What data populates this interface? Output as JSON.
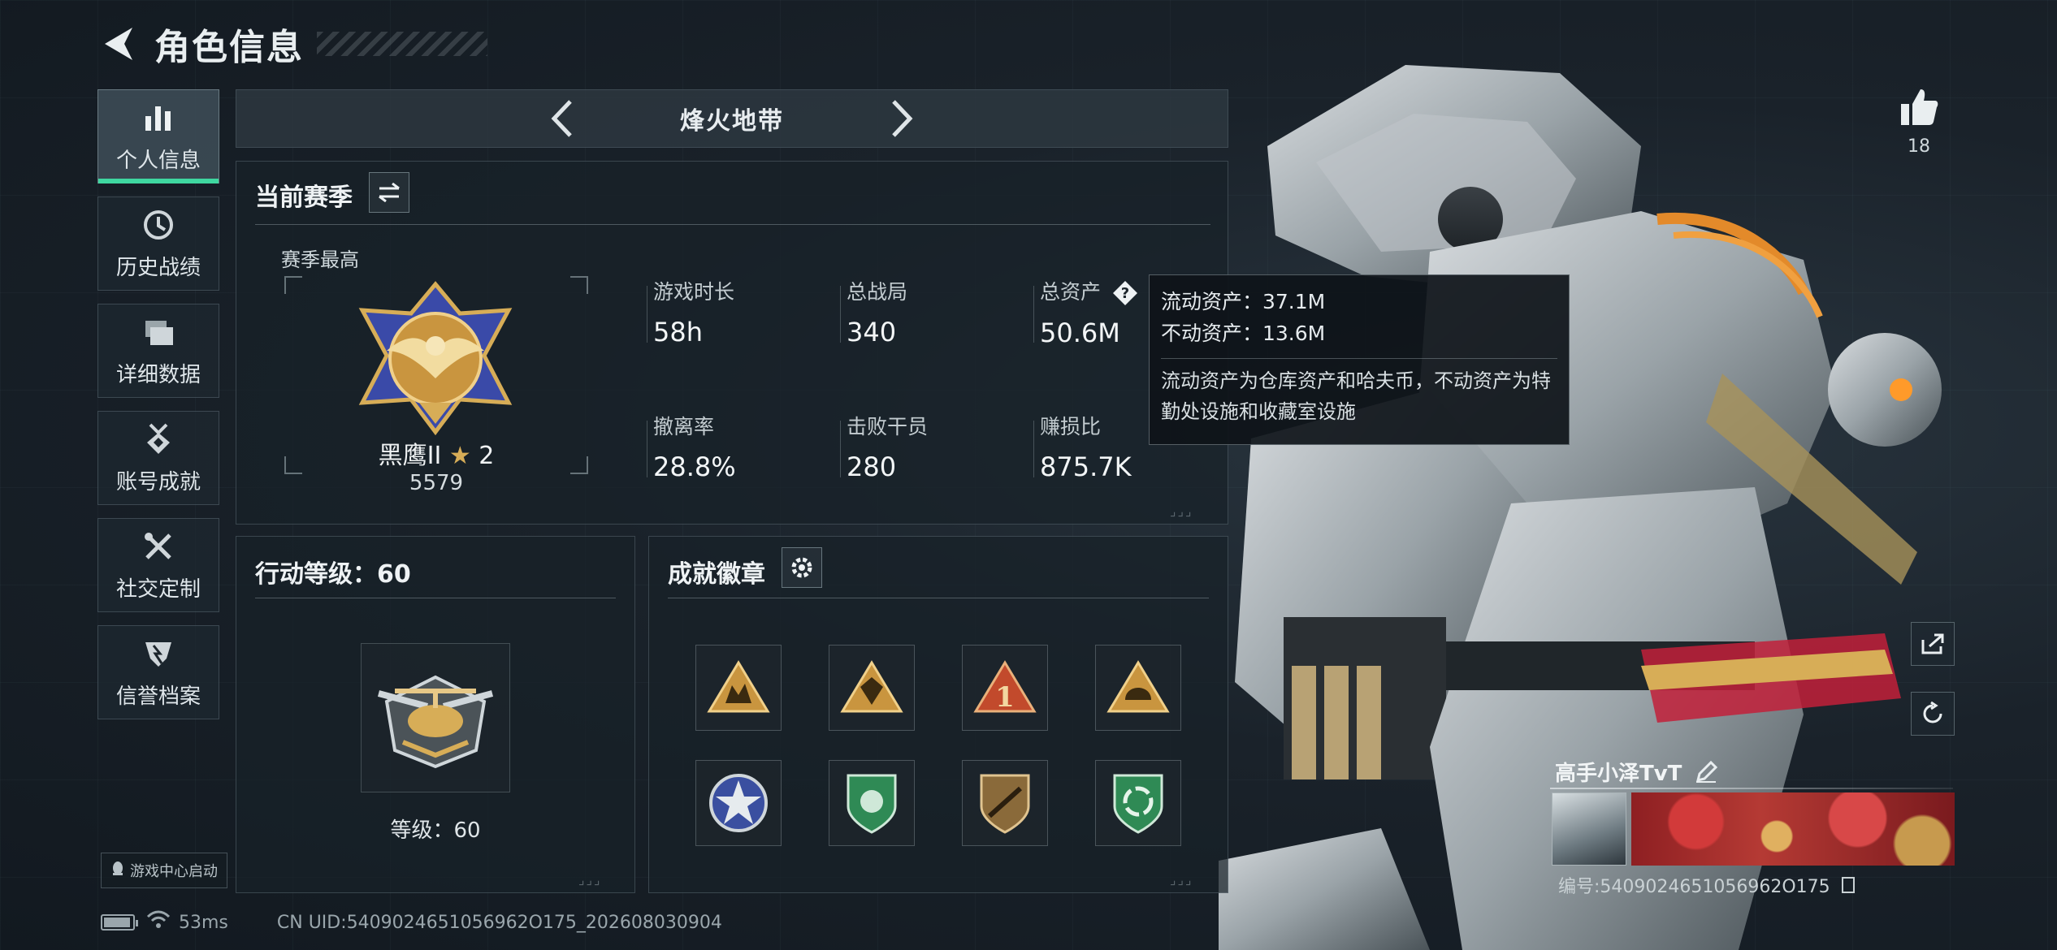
{
  "header": {
    "title": "角色信息"
  },
  "sidebar": {
    "items": [
      {
        "label": "个人信息",
        "icon": "bar-chart-icon",
        "active": true
      },
      {
        "label": "历史战绩",
        "icon": "clock-icon"
      },
      {
        "label": "详细数据",
        "icon": "folder-icon"
      },
      {
        "label": "账号成就",
        "icon": "medal-icon"
      },
      {
        "label": "社交定制",
        "icon": "tools-icon"
      },
      {
        "label": "信誉档案",
        "icon": "shield-icon"
      }
    ],
    "game_center": "游戏中心启动"
  },
  "mode_selector": {
    "label": "烽火地带"
  },
  "season": {
    "title": "当前赛季",
    "best_label": "赛季最高",
    "rank_name": "黑鹰II",
    "rank_stars": "2",
    "rank_score": "5579",
    "stats": [
      {
        "label": "游戏时长",
        "value": "58h"
      },
      {
        "label": "总战局",
        "value": "340"
      },
      {
        "label": "总资产",
        "value": "50.6M"
      },
      {
        "label": "撤离率",
        "value": "28.8%"
      },
      {
        "label": "击败干员",
        "value": "280"
      },
      {
        "label": "赚损比",
        "value": "875.7K"
      }
    ]
  },
  "tooltip": {
    "liquid": "流动资产：37.1M",
    "fixed": "不动资产：13.6M",
    "description": "流动资产为仓库资产和哈夫币，不动资产为特勤处设施和收藏室设施"
  },
  "action_level": {
    "title": "行动等级：60",
    "level_label": "等级：60"
  },
  "achievements": {
    "title": "成就徽章",
    "badges": [
      {
        "icon": "soldiers-badge-icon",
        "color": "#c9953f"
      },
      {
        "icon": "shield-badge-icon",
        "color": "#c9953f"
      },
      {
        "icon": "number-one-badge-icon",
        "color": "#c24a2c"
      },
      {
        "icon": "helmet-badge-icon",
        "color": "#c9953f"
      },
      {
        "icon": "star-badge-icon",
        "color": "#3a4fa0"
      },
      {
        "icon": "green-shield-badge-icon",
        "color": "#2f8a55"
      },
      {
        "icon": "rifle-badge-icon",
        "color": "#8a6a3a"
      },
      {
        "icon": "recycle-badge-icon",
        "color": "#2f8a55"
      }
    ]
  },
  "status_bar": {
    "ping": "53ms",
    "uid": "CN UID:5409024651056962O175_202608030904"
  },
  "profile": {
    "likes": "18",
    "player_name": "高手小泽TvT",
    "player_id": "编号:5409024651056962O175"
  },
  "colors": {
    "accent": "#3fd7a0",
    "gold": "#d7ad57"
  }
}
